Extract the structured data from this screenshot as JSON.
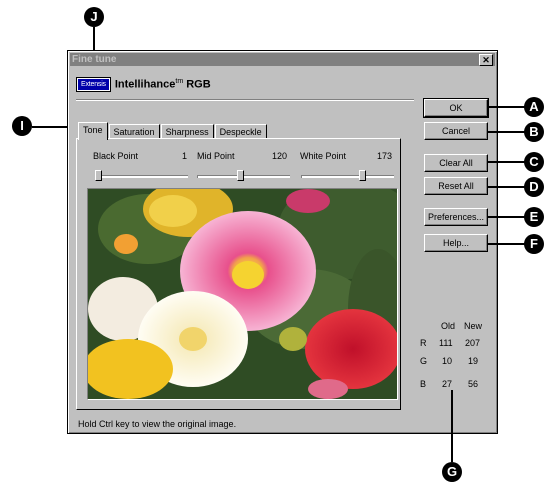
{
  "window": {
    "title": "Fine tune",
    "close_glyph": "✕"
  },
  "brand": {
    "logo": "Extensis",
    "product": "Intellihance",
    "sup": "tm",
    "suffix": " RGB"
  },
  "tabs": [
    "Tone",
    "Saturation",
    "Sharpness",
    "Despeckle"
  ],
  "sliders": [
    {
      "label": "Black Point",
      "value": "1",
      "level": 0.0
    },
    {
      "label": "Mid Point",
      "value": "120",
      "level": 0.47
    },
    {
      "label": "White Point",
      "value": "173",
      "level": 0.68
    }
  ],
  "buttons": {
    "ok": "OK",
    "cancel": "Cancel",
    "clear_all": "Clear All",
    "reset_all": "Reset All",
    "preferences": "Preferences...",
    "help": "Help..."
  },
  "rgb_table": {
    "headers": [
      "Old",
      "New"
    ],
    "rows": [
      {
        "channel": "R",
        "old": "111",
        "new": "207"
      },
      {
        "channel": "G",
        "old": "10",
        "new": "19"
      },
      {
        "channel": "B",
        "old": "27",
        "new": "56"
      }
    ]
  },
  "status": "Hold Ctrl key to view the original image.",
  "callouts": {
    "a": "A",
    "b": "B",
    "c": "C",
    "d": "D",
    "e": "E",
    "f": "F",
    "g": "G",
    "i": "I",
    "j": "J"
  }
}
